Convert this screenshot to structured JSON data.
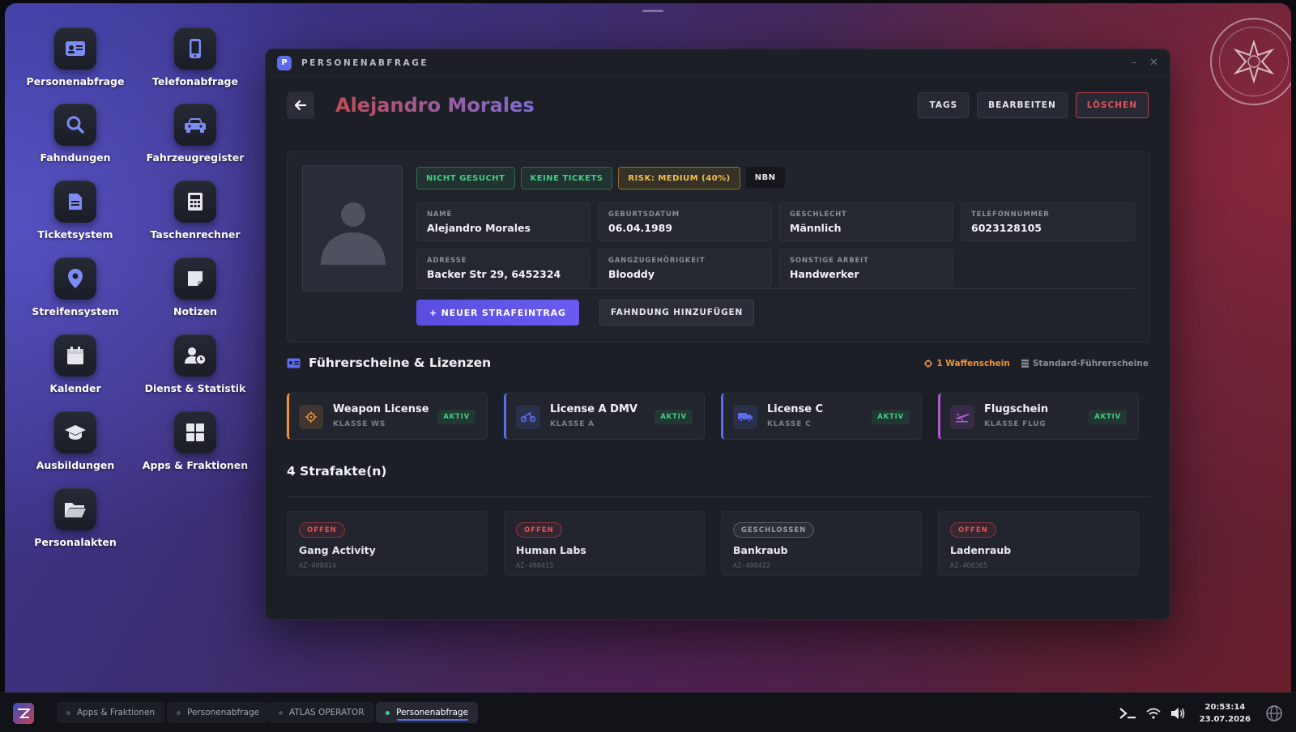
{
  "desktop": {
    "icons": [
      {
        "label": "Personenabfrage",
        "icon": "id-card-icon"
      },
      {
        "label": "Telefonabfrage",
        "icon": "phone-icon"
      },
      {
        "label": "Fahndungen",
        "icon": "search-icon"
      },
      {
        "label": "Fahrzeugregister",
        "icon": "car-icon"
      },
      {
        "label": "Ticketsystem",
        "icon": "document-icon"
      },
      {
        "label": "Taschenrechner",
        "icon": "calculator-icon"
      },
      {
        "label": "Streifensystem",
        "icon": "map-pin-icon"
      },
      {
        "label": "Notizen",
        "icon": "note-icon"
      },
      {
        "label": "Kalender",
        "icon": "calendar-icon"
      },
      {
        "label": "Dienst & Statistik",
        "icon": "user-clock-icon"
      },
      {
        "label": "Ausbildungen",
        "icon": "graduation-cap-icon"
      },
      {
        "label": "Apps & Fraktionen",
        "icon": "grid-icon"
      },
      {
        "label": "Personalakten",
        "icon": "folder-open-icon"
      }
    ]
  },
  "window": {
    "logo_letter": "P",
    "title": "PERSONENABFRAGE",
    "minimize": "–",
    "close": "✕"
  },
  "header": {
    "person_name": "Alejandro Morales",
    "buttons": {
      "tags": "TAGS",
      "edit": "BEARBEITEN",
      "delete": "LÖSCHEN"
    }
  },
  "profile": {
    "badges": {
      "wanted": "NICHT GESUCHT",
      "tickets": "KEINE TICKETS",
      "risk": "RISK: MEDIUM (40%)",
      "tag": "NBN"
    },
    "fields": {
      "name": {
        "label": "NAME",
        "value": "Alejandro Morales"
      },
      "birth": {
        "label": "GEBURTSDATUM",
        "value": "06.04.1989"
      },
      "gender": {
        "label": "GESCHLECHT",
        "value": "Männlich"
      },
      "phone": {
        "label": "TELEFONNUMMER",
        "value": "6023128105"
      },
      "address": {
        "label": "ADRESSE",
        "value": "Backer Str 29, 6452324"
      },
      "gang": {
        "label": "GANGZUGEHÖRIGKEIT",
        "value": "Blooddy"
      },
      "job": {
        "label": "SONSTIGE ARBEIT",
        "value": "Handwerker"
      }
    },
    "actions": {
      "new_record": "+ NEUER STRAFEINTRAG",
      "add_warrant": "FAHNDUNG HINZUFÜGEN"
    }
  },
  "licenses": {
    "title": "Führerscheine & Lizenzen",
    "meta_weapon": "1 Waffenschein",
    "meta_standard": "Standard-Führerscheine",
    "items": [
      {
        "name": "Weapon License",
        "class": "KLASSE WS",
        "status": "AKTIV",
        "icon": "crosshair-icon",
        "color": "#f0913a"
      },
      {
        "name": "License A DMV",
        "class": "KLASSE A",
        "status": "AKTIV",
        "icon": "motorcycle-icon",
        "color": "#5b6cf0"
      },
      {
        "name": "License C",
        "class": "KLASSE C",
        "status": "AKTIV",
        "icon": "truck-icon",
        "color": "#5b6cf0"
      },
      {
        "name": "Flugschein",
        "class": "KLASSE FLUG",
        "status": "AKTIV",
        "icon": "plane-icon",
        "color": "#b05ad0"
      }
    ]
  },
  "cases": {
    "title": "4 Strafakte(n)",
    "items": [
      {
        "status": "OFFEN",
        "title": "Gang Activity",
        "id": "AZ-408414"
      },
      {
        "status": "OFFEN",
        "title": "Human Labs",
        "id": "AZ-408413"
      },
      {
        "status": "GESCHLOSSEN",
        "title": "Bankraub",
        "id": "AZ-408412"
      },
      {
        "status": "OFFEN",
        "title": "Ladenraub",
        "id": "AZ-408365"
      }
    ]
  },
  "taskbar": {
    "items": [
      "Apps & Fraktionen",
      "Personenabfrage",
      "ATLAS OPERATOR",
      "Personenabfrage"
    ],
    "active_index": 3,
    "time": "20:53:14",
    "date": "23.07.2026"
  },
  "colors": {
    "accent": "#5b6cf0",
    "danger": "#e0525c",
    "success": "#3fcf86",
    "warning": "#f2c14a"
  }
}
